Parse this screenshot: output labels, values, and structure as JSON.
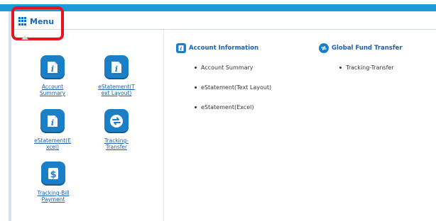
{
  "header": {
    "menu_label": "Menu"
  },
  "tiles": [
    {
      "label_line1": "Account",
      "label_line2": "Summary",
      "icon": "info-document-icon"
    },
    {
      "label_line1": "eStatement(T",
      "label_line2": "ext Layout)",
      "icon": "info-document-icon"
    },
    {
      "label_line1": "eStatement(E",
      "label_line2": "xcel)",
      "icon": "info-document-icon"
    },
    {
      "label_line1": "Tracking-",
      "label_line2": "Transfer",
      "icon": "transfer-arrows-icon"
    },
    {
      "label_line1": "Tracking-Bill",
      "label_line2": "Payment",
      "icon": "dollar-icon"
    }
  ],
  "sections": {
    "account_information": {
      "title": "Account Information",
      "icon": "info-document-icon",
      "items": [
        "Account Summary",
        "eStatement(Text Layout)",
        "eStatement(Excel)"
      ]
    },
    "global_fund_transfer": {
      "title": "Global Fund Transfer",
      "icon": "transfer-arrows-icon",
      "items": [
        "Tracking-Transfer"
      ]
    }
  },
  "colors": {
    "accent": "#1c9ad6",
    "link": "#1a5fb4",
    "icon_bg": "#1b7fc8",
    "highlight": "#e4151f"
  }
}
